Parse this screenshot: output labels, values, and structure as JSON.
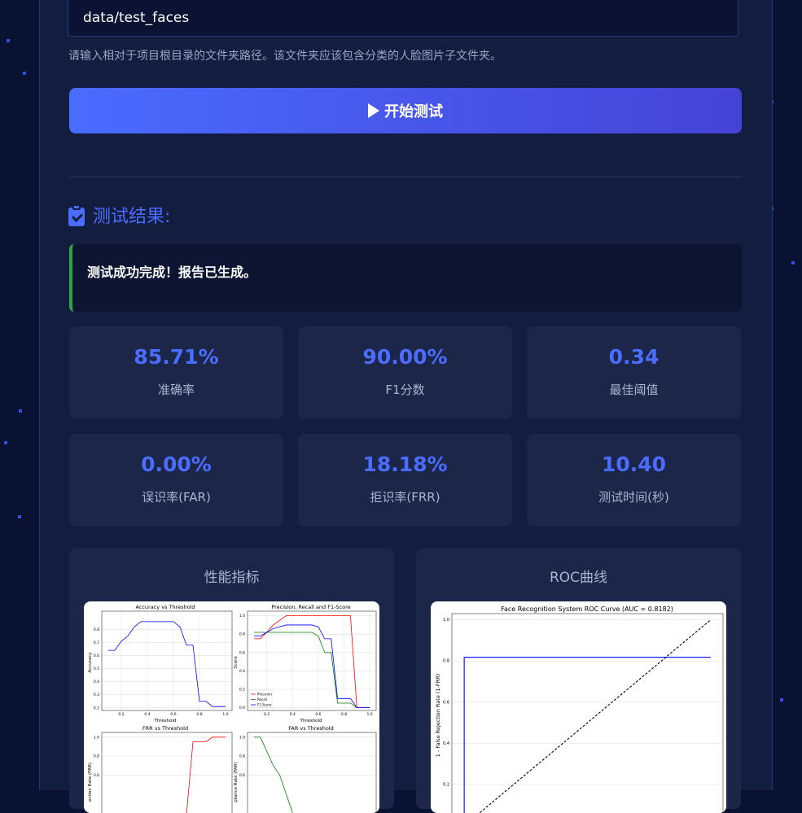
{
  "test_form": {
    "folder_path_value": "data/test_faces",
    "hint": "请输入相对于项目根目录的文件夹路径。该文件夹应该包含分类的人脸图片子文件夹。",
    "start_button_label": "开始测试"
  },
  "results": {
    "heading": "测试结果:",
    "success_message": "测试成功完成！报告已生成。",
    "metrics": [
      {
        "value": "85.71%",
        "label": "准确率"
      },
      {
        "value": "90.00%",
        "label": "F1分数"
      },
      {
        "value": "0.34",
        "label": "最佳阈值"
      },
      {
        "value": "0.00%",
        "label": "误识率(FAR)"
      },
      {
        "value": "18.18%",
        "label": "拒识率(FRR)"
      },
      {
        "value": "10.40",
        "label": "测试时间(秒)"
      }
    ]
  },
  "charts": {
    "performance": {
      "card_title": "性能指标",
      "accuracy": {
        "title": "Accuracy vs Threshold",
        "xlabel": "Threshold",
        "ylabel": "Accuracy"
      },
      "prf": {
        "title": "Precision, Recall and F1-Score",
        "xlabel": "Threshold",
        "ylabel": "Score",
        "legend": [
          "Precision",
          "Recall",
          "F1-Score"
        ]
      },
      "frr": {
        "title": "FRR vs Threshold",
        "ylabel": "ection Rate (FRR)"
      },
      "far": {
        "title": "FAR vs Threshold",
        "ylabel": "ptance Rate (FAR)"
      }
    },
    "roc": {
      "card_title": "ROC曲线",
      "title": "Face Recognition System ROC Curve (AUC = 0.8182)",
      "ylabel": "1 - False Rejection Rate (1-FRR)"
    }
  },
  "chart_data": [
    {
      "type": "line",
      "title": "Accuracy vs Threshold",
      "xlabel": "Threshold",
      "ylabel": "Accuracy",
      "xlim": [
        0.05,
        1.05
      ],
      "ylim": [
        0.18,
        0.94
      ],
      "x_ticks": [
        0.2,
        0.4,
        0.6,
        0.8,
        1.0
      ],
      "y_ticks": [
        0.2,
        0.3,
        0.4,
        0.5,
        0.6,
        0.7,
        0.8
      ],
      "series": [
        {
          "color": "#0000ff",
          "x": [
            0.1,
            0.15,
            0.2,
            0.25,
            0.3,
            0.35,
            0.4,
            0.45,
            0.5,
            0.55,
            0.6,
            0.65,
            0.7,
            0.75,
            0.8,
            0.85,
            0.9,
            0.95,
            1.0
          ],
          "y": [
            0.64,
            0.64,
            0.71,
            0.75,
            0.82,
            0.86,
            0.86,
            0.86,
            0.86,
            0.86,
            0.86,
            0.82,
            0.68,
            0.68,
            0.25,
            0.25,
            0.21,
            0.21,
            0.21
          ]
        }
      ]
    },
    {
      "type": "line",
      "title": "Precision, Recall and F1-Score",
      "xlabel": "Threshold",
      "ylabel": "Score",
      "xlim": [
        0.05,
        1.05
      ],
      "ylim": [
        -0.03,
        1.05
      ],
      "x_ticks": [
        0.2,
        0.4,
        0.6,
        0.8,
        1.0
      ],
      "y_ticks": [
        0.0,
        0.2,
        0.4,
        0.6,
        0.8,
        1.0
      ],
      "legend": "lower-left",
      "series": [
        {
          "name": "Precision",
          "color": "#ff0000",
          "x": [
            0.1,
            0.15,
            0.2,
            0.25,
            0.3,
            0.35,
            0.4,
            0.45,
            0.5,
            0.55,
            0.6,
            0.65,
            0.7,
            0.75,
            0.8,
            0.85,
            0.9,
            0.95,
            1.0
          ],
          "y": [
            0.75,
            0.75,
            0.82,
            0.9,
            0.95,
            1.0,
            1.0,
            1.0,
            1.0,
            1.0,
            1.0,
            1.0,
            1.0,
            1.0,
            1.0,
            1.0,
            0.0,
            0.0,
            0.0
          ]
        },
        {
          "name": "Recall",
          "color": "#008000",
          "x": [
            0.1,
            0.15,
            0.2,
            0.25,
            0.3,
            0.35,
            0.4,
            0.45,
            0.5,
            0.55,
            0.6,
            0.65,
            0.7,
            0.75,
            0.8,
            0.85,
            0.9,
            0.95,
            1.0
          ],
          "y": [
            0.82,
            0.82,
            0.82,
            0.82,
            0.82,
            0.82,
            0.82,
            0.82,
            0.82,
            0.82,
            0.78,
            0.6,
            0.6,
            0.05,
            0.05,
            0.05,
            0.0,
            0.0,
            0.0
          ]
        },
        {
          "name": "F1-Score",
          "color": "#0000ff",
          "x": [
            0.1,
            0.15,
            0.2,
            0.25,
            0.3,
            0.35,
            0.4,
            0.45,
            0.5,
            0.55,
            0.6,
            0.65,
            0.7,
            0.75,
            0.8,
            0.85,
            0.9,
            0.95,
            1.0
          ],
          "y": [
            0.78,
            0.78,
            0.82,
            0.86,
            0.88,
            0.9,
            0.9,
            0.9,
            0.9,
            0.9,
            0.88,
            0.75,
            0.75,
            0.1,
            0.1,
            0.1,
            0.0,
            0.0,
            0.0
          ]
        }
      ]
    },
    {
      "type": "line",
      "title": "FRR vs Threshold",
      "xlim": [
        0.05,
        1.05
      ],
      "ylim": [
        0.0,
        1.05
      ],
      "y_ticks": [
        0.6,
        0.8,
        1.0
      ],
      "series": [
        {
          "color": "#ff0000",
          "x": [
            0.1,
            0.2,
            0.3,
            0.4,
            0.5,
            0.6,
            0.7,
            0.75,
            0.8,
            0.85,
            0.9,
            0.95,
            1.0
          ],
          "y": [
            0.0,
            0.0,
            0.0,
            0.0,
            0.0,
            0.0,
            0.18,
            0.95,
            0.95,
            0.95,
            1.0,
            1.0,
            1.0
          ]
        }
      ]
    },
    {
      "type": "line",
      "title": "FAR vs Threshold",
      "xlim": [
        0.05,
        1.05
      ],
      "ylim": [
        0.0,
        1.05
      ],
      "y_ticks": [
        0.6,
        0.8,
        1.0
      ],
      "series": [
        {
          "color": "#008000",
          "x": [
            0.1,
            0.15,
            0.2,
            0.25,
            0.3,
            0.35,
            0.4
          ],
          "y": [
            1.0,
            1.0,
            0.85,
            0.7,
            0.6,
            0.4,
            0.2
          ]
        }
      ]
    },
    {
      "type": "line",
      "title": "Face Recognition System ROC Curve (AUC = 0.8182)",
      "ylabel": "1 - False Rejection Rate (1-FRR)",
      "xlim": [
        -0.05,
        1.05
      ],
      "ylim": [
        0.05,
        1.03
      ],
      "y_ticks": [
        0.2,
        0.4,
        0.6,
        0.8,
        1.0
      ],
      "series": [
        {
          "color": "#0000ff",
          "style": "solid",
          "x": [
            0.0,
            0.0,
            1.0
          ],
          "y": [
            0.0,
            0.818,
            0.818
          ]
        },
        {
          "color": "#000000",
          "style": "dashed",
          "x": [
            0.0,
            1.0
          ],
          "y": [
            0.0,
            1.0
          ]
        }
      ]
    }
  ]
}
